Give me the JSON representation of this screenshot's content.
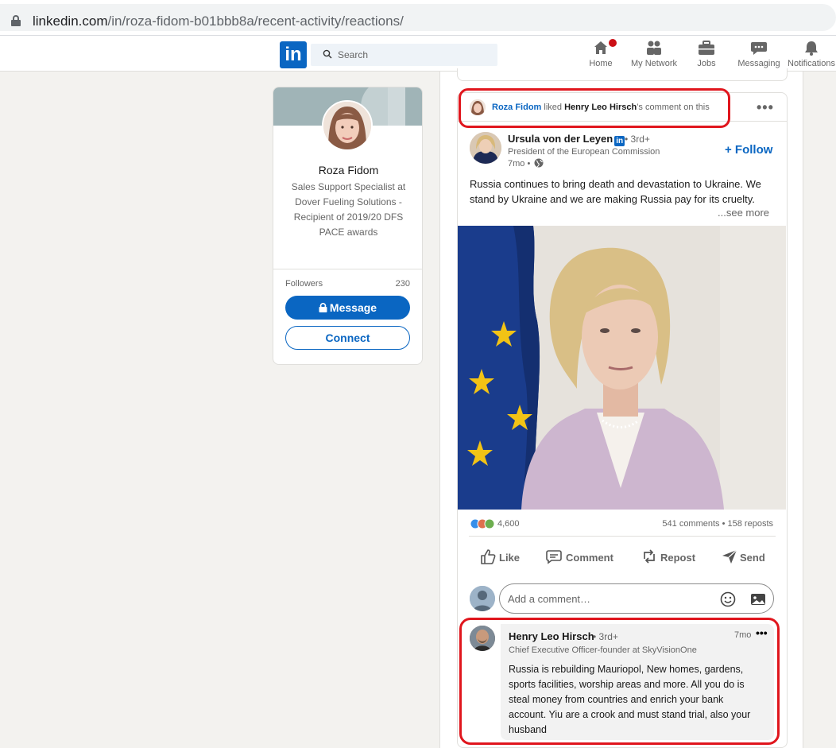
{
  "browser": {
    "url_domain": "linkedin.com",
    "url_path": "/in/roza-fidom-b01bbb8a/recent-activity/reactions/"
  },
  "nav": {
    "logo": "in",
    "search_placeholder": "Search",
    "items": [
      {
        "label": "Home",
        "icon": "home-icon"
      },
      {
        "label": "My Network",
        "icon": "network-icon"
      },
      {
        "label": "Jobs",
        "icon": "briefcase-icon"
      },
      {
        "label": "Messaging",
        "icon": "messaging-icon"
      },
      {
        "label": "Notifications",
        "icon": "bell-icon"
      }
    ]
  },
  "profile": {
    "name": "Roza Fidom",
    "headline": "Sales Support Specialist at Dover Fueling Solutions - Recipient of 2019/20 DFS PACE awards",
    "followers_label": "Followers",
    "followers_count": "230",
    "message_label": "Message",
    "connect_label": "Connect"
  },
  "post": {
    "activity": {
      "actor": "Roza Fidom",
      "verb": " liked ",
      "target": "Henry Leo Hirsch",
      "suffix": "’s comment on this"
    },
    "author": {
      "name": "Ursula von der Leyen",
      "degree": "• 3rd+",
      "title": "President of the European Commission",
      "time": "7mo •"
    },
    "follow_label": "+ Follow",
    "text": "Russia continues to bring death and devastation to Ukraine. We stand by Ukraine and we are making Russia pay for its cruelty.",
    "see_more": "...see more",
    "reactions_count": "4,600",
    "stats": "541 comments • 158 reposts",
    "actions": {
      "like": "Like",
      "comment": "Comment",
      "repost": "Repost",
      "send": "Send"
    },
    "comment_placeholder": "Add a comment…"
  },
  "comment": {
    "name": "Henry Leo Hirsch",
    "degree": "• 3rd+",
    "time": "7mo",
    "title": "Chief Executive Officer-founder at SkyVisionOne",
    "text": "Russia is rebuilding Mauriopol, New homes, gardens, sports facilities, worship areas and more. All you do is steal money from countries and enrich your bank account. Yiu are a crook and must stand trial, also your husband"
  },
  "colors": {
    "brand": "#0a66c2",
    "highlight": "#e0161d",
    "page_bg": "#f3f2ef"
  }
}
